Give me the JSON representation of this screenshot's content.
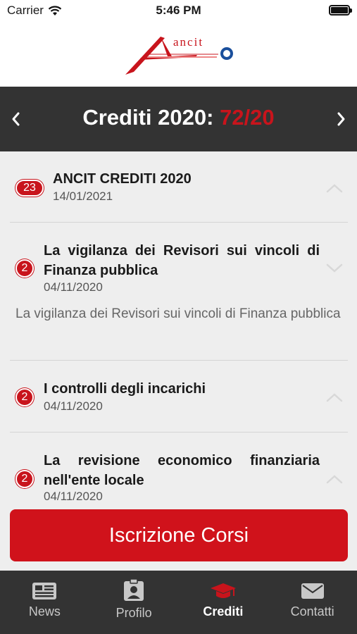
{
  "status_bar": {
    "carrier": "Carrier",
    "time": "5:46 PM"
  },
  "logo": {
    "text": "ancit"
  },
  "header": {
    "title_prefix": "Crediti 2020:",
    "title_value": "72/20",
    "accent_color": "#c8141c"
  },
  "courses": [
    {
      "badge": "23",
      "title": "ANCIT CREDITI 2020",
      "date": "14/01/2021",
      "description": "",
      "expanded": false
    },
    {
      "badge": "2",
      "title": "La vigilanza dei Revisori sui vincoli di Finanza pubblica",
      "date": "04/11/2020",
      "description": "La vigilanza dei Revisori sui vincoli di Finanza pubblica",
      "expanded": true
    },
    {
      "badge": "2",
      "title": "I controlli degli incarichi",
      "date": "04/11/2020",
      "description": "",
      "expanded": false
    },
    {
      "badge": "2",
      "title": "La revisione economico finanziaria nell'ente locale",
      "date": "04/11/2020",
      "description": "",
      "expanded": false
    }
  ],
  "action_button": {
    "label": "Iscrizione Corsi",
    "color": "#d0121b"
  },
  "tabs": [
    {
      "label": "News",
      "icon": "newspaper-icon",
      "active": false
    },
    {
      "label": "Profilo",
      "icon": "id-badge-icon",
      "active": false
    },
    {
      "label": "Crediti",
      "icon": "graduation-cap-icon",
      "active": true
    },
    {
      "label": "Contatti",
      "icon": "envelope-icon",
      "active": false
    }
  ]
}
